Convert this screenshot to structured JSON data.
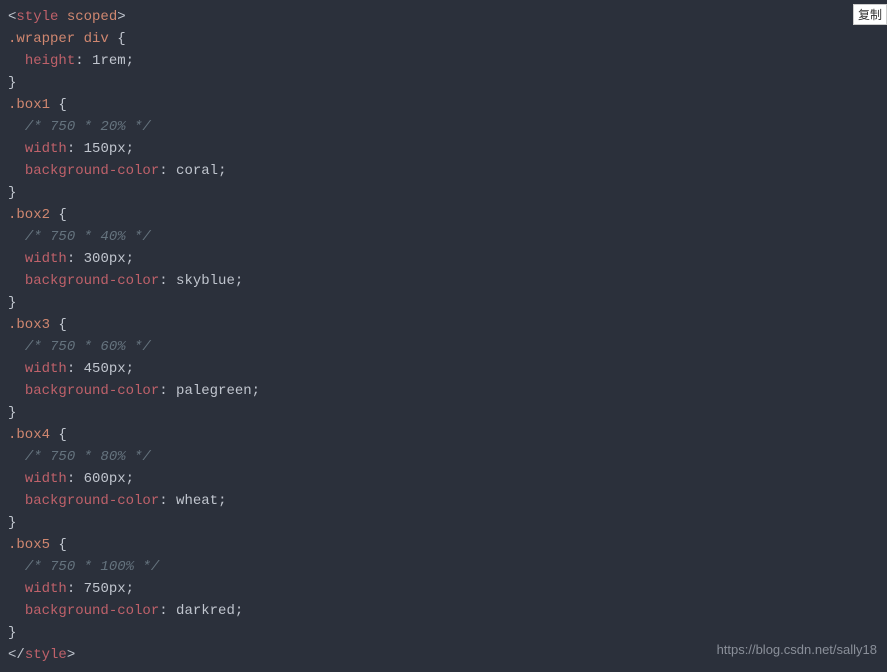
{
  "copyButton": "复制",
  "watermark": "https://blog.csdn.net/sally18",
  "code": {
    "line1": {
      "bracket1": "<",
      "tag": "style",
      "sp": " ",
      "attr": "scoped",
      "bracket2": ">"
    },
    "line2": {
      "sel": ".wrapper div",
      "sp": " ",
      "brace": "{"
    },
    "line3": {
      "indent": "  ",
      "prop": "height",
      "colon": ":",
      "sp": " ",
      "val": "1rem",
      "semi": ";"
    },
    "line4": {
      "brace": "}"
    },
    "line5": {
      "sel": ".box1",
      "sp": " ",
      "brace": "{"
    },
    "line6": {
      "indent": "  ",
      "comment": "/* 750 * 20% */"
    },
    "line7": {
      "indent": "  ",
      "prop": "width",
      "colon": ":",
      "sp": " ",
      "val": "150px",
      "semi": ";"
    },
    "line8": {
      "indent": "  ",
      "prop": "background-color",
      "colon": ":",
      "sp": " ",
      "val": "coral",
      "semi": ";"
    },
    "line9": {
      "brace": "}"
    },
    "line10": {
      "sel": ".box2",
      "sp": " ",
      "brace": "{"
    },
    "line11": {
      "indent": "  ",
      "comment": "/* 750 * 40% */"
    },
    "line12": {
      "indent": "  ",
      "prop": "width",
      "colon": ":",
      "sp": " ",
      "val": "300px",
      "semi": ";"
    },
    "line13": {
      "indent": "  ",
      "prop": "background-color",
      "colon": ":",
      "sp": " ",
      "val": "skyblue",
      "semi": ";"
    },
    "line14": {
      "brace": "}"
    },
    "line15": {
      "sel": ".box3",
      "sp": " ",
      "brace": "{"
    },
    "line16": {
      "indent": "  ",
      "comment": "/* 750 * 60% */"
    },
    "line17": {
      "indent": "  ",
      "prop": "width",
      "colon": ":",
      "sp": " ",
      "val": "450px",
      "semi": ";"
    },
    "line18": {
      "indent": "  ",
      "prop": "background-color",
      "colon": ":",
      "sp": " ",
      "val": "palegreen",
      "semi": ";"
    },
    "line19": {
      "brace": "}"
    },
    "line20": {
      "sel": ".box4",
      "sp": " ",
      "brace": "{"
    },
    "line21": {
      "indent": "  ",
      "comment": "/* 750 * 80% */"
    },
    "line22": {
      "indent": "  ",
      "prop": "width",
      "colon": ":",
      "sp": " ",
      "val": "600px",
      "semi": ";"
    },
    "line23": {
      "indent": "  ",
      "prop": "background-color",
      "colon": ":",
      "sp": " ",
      "val": "wheat",
      "semi": ";"
    },
    "line24": {
      "brace": "}"
    },
    "line25": {
      "sel": ".box5",
      "sp": " ",
      "brace": "{"
    },
    "line26": {
      "indent": "  ",
      "comment": "/* 750 * 100% */"
    },
    "line27": {
      "indent": "  ",
      "prop": "width",
      "colon": ":",
      "sp": " ",
      "val": "750px",
      "semi": ";"
    },
    "line28": {
      "indent": "  ",
      "prop": "background-color",
      "colon": ":",
      "sp": " ",
      "val": "darkred",
      "semi": ";"
    },
    "line29": {
      "brace": "}"
    },
    "line30": {
      "bracket1": "</",
      "tag": "style",
      "bracket2": ">"
    }
  }
}
